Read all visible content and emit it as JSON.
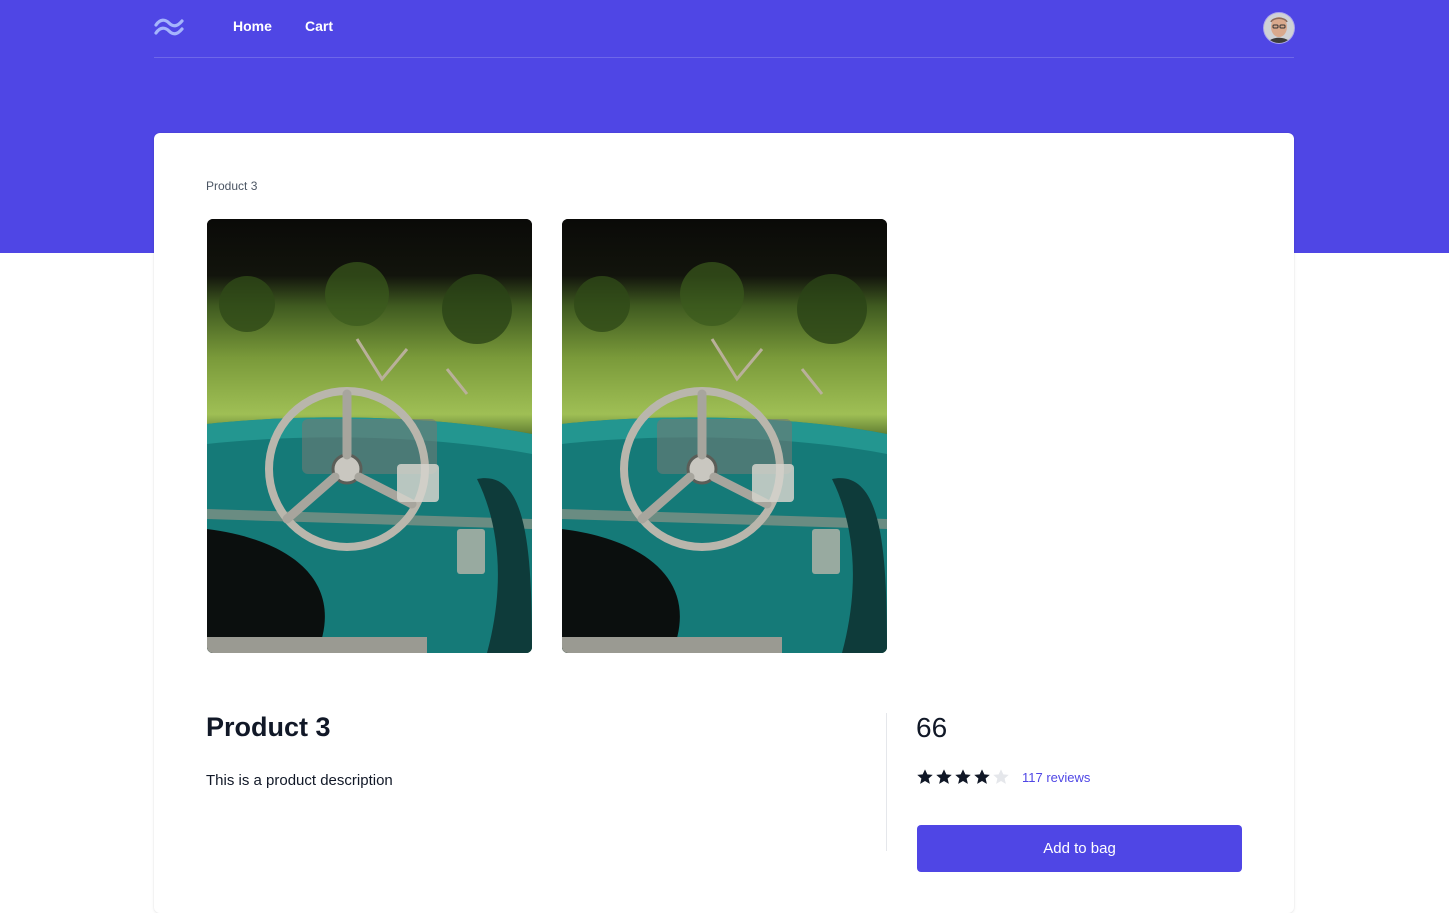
{
  "nav": {
    "logo_icon": "tailwind-wave-icon",
    "links": [
      "Home",
      "Cart"
    ],
    "avatar_icon": "user-avatar"
  },
  "breadcrumb": "Product 3",
  "gallery": {
    "image_count": 2,
    "subject": "vintage-car-steering-wheel-photo"
  },
  "product": {
    "title": "Product 3",
    "description": "This is a product description",
    "price": "66",
    "rating": 4,
    "rating_max": 5,
    "reviews_label": "117 reviews",
    "add_to_bag_label": "Add to bag"
  },
  "colors": {
    "brand": "#4f46e5",
    "text": "#111827",
    "star_filled": "#111827",
    "star_empty": "#e5e7eb"
  }
}
